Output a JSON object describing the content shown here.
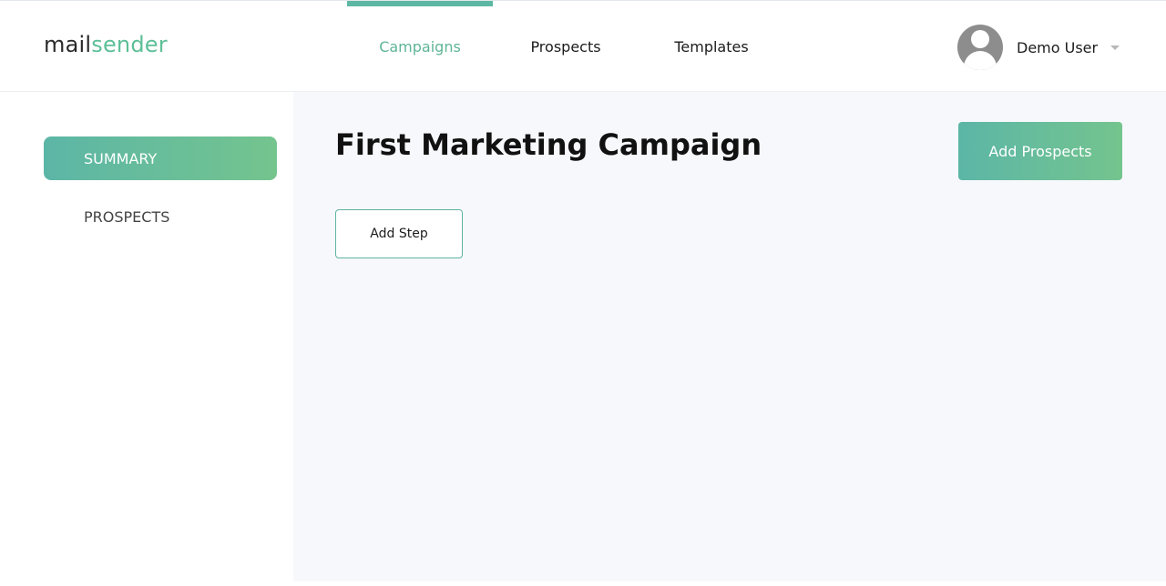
{
  "header": {
    "logo": {
      "part1": "mail",
      "part2": "sender"
    },
    "nav": [
      {
        "label": "Campaigns",
        "active": true
      },
      {
        "label": "Prospects",
        "active": false
      },
      {
        "label": "Templates",
        "active": false
      }
    ],
    "user": {
      "name": "Demo User",
      "avatar_icon": "user-avatar-icon",
      "menu_icon": "caret-down-icon"
    }
  },
  "sidebar": {
    "items": [
      {
        "label": "SUMMARY",
        "active": true
      },
      {
        "label": "PROSPECTS",
        "active": false
      }
    ]
  },
  "main": {
    "title": "First Marketing Campaign",
    "add_prospects_label": "Add Prospects",
    "add_step_label": "Add Step"
  },
  "colors": {
    "accent": "#5db8a3",
    "accent_gradient_start": "#5cb6a6",
    "accent_gradient_end": "#74c48e",
    "main_background": "#f7f8fc"
  }
}
